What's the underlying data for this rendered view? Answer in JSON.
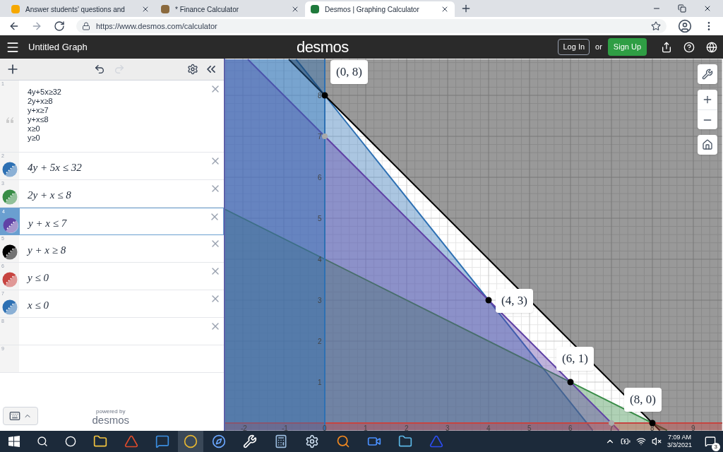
{
  "browser": {
    "tabs": [
      {
        "title": "Answer students' questions and",
        "selected": false
      },
      {
        "title": "* Finance Calculator",
        "selected": false
      },
      {
        "title": "Desmos | Graphing Calculator",
        "selected": true
      }
    ],
    "url": "https://www.desmos.com/calculator"
  },
  "header": {
    "title": "Untitled Graph",
    "logo": "desmos",
    "login": "Log In",
    "or": "or",
    "signup": "Sign Up"
  },
  "expressions": [
    {
      "number": "1",
      "kind": "note",
      "text": "4y+5x≥32\n2y+x≥8\ny+x≥7\ny+x≤8\nx≥0\ny≥0",
      "selected": false
    },
    {
      "number": "2",
      "kind": "math",
      "text": "4y + 5x ≤ 32",
      "color": "#2d70b3",
      "selected": false
    },
    {
      "number": "3",
      "kind": "math",
      "text": "2y + x ≤ 8",
      "color": "#388c46",
      "selected": false
    },
    {
      "number": "4",
      "kind": "math",
      "text": "y + x ≤ 7",
      "color": "#6042a6",
      "selected": true
    },
    {
      "number": "5",
      "kind": "math",
      "text": "y + x ≥ 8",
      "color": "#000000",
      "selected": false
    },
    {
      "number": "6",
      "kind": "math",
      "text": "y ≤ 0",
      "color": "#c74440",
      "selected": false
    },
    {
      "number": "7",
      "kind": "math",
      "text": "x ≤ 0",
      "color": "#2d70b3",
      "selected": false
    },
    {
      "number": "8",
      "kind": "empty",
      "selected": false
    },
    {
      "number": "9",
      "kind": "placeholder",
      "selected": false
    }
  ],
  "powered_by": {
    "line1": "powered by",
    "line2": "desmos"
  },
  "graph": {
    "x_ticks": [
      "-2",
      "-1",
      "0",
      "1",
      "2",
      "3",
      "4",
      "5",
      "6",
      "7",
      "8",
      "9"
    ],
    "y_ticks": [
      "8",
      "7",
      "6",
      "5",
      "4",
      "3",
      "2",
      "1"
    ],
    "points": [
      {
        "label": "(0, 8)"
      },
      {
        "label": "(4, 3)"
      },
      {
        "label": "(6, 1)"
      },
      {
        "label": "(8, 0)"
      }
    ]
  },
  "taskbar": {
    "time": "7:09 AM",
    "date": "3/3/2021",
    "notifications": "3"
  }
}
